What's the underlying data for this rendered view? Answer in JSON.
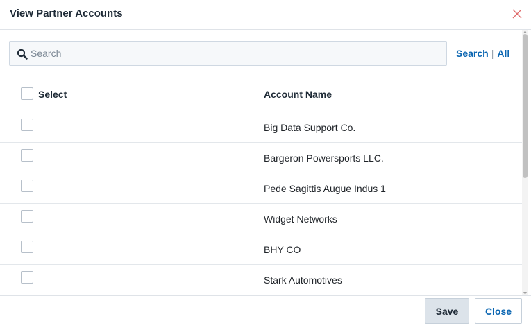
{
  "dialog": {
    "title": "View Partner Accounts",
    "close_icon": "close-icon"
  },
  "search": {
    "placeholder": "Search",
    "value": "",
    "search_link": "Search",
    "separator": "|",
    "all_link": "All",
    "icon": "search-icon"
  },
  "table": {
    "select_label": "Select",
    "column_header": "Account Name",
    "rows": [
      {
        "name": "Big Data Support Co.",
        "checked": false
      },
      {
        "name": "Bargeron Powersports LLC.",
        "checked": false
      },
      {
        "name": "Pede Sagittis Augue Indus 1",
        "checked": false
      },
      {
        "name": "Widget Networks",
        "checked": false
      },
      {
        "name": "BHY CO",
        "checked": false
      },
      {
        "name": "Stark Automotives",
        "checked": false
      }
    ]
  },
  "footer": {
    "save_label": "Save",
    "close_label": "Close"
  },
  "colors": {
    "link": "#0b66b2",
    "close_icon": "#e06c6c",
    "save_bg": "#dce3ea"
  }
}
